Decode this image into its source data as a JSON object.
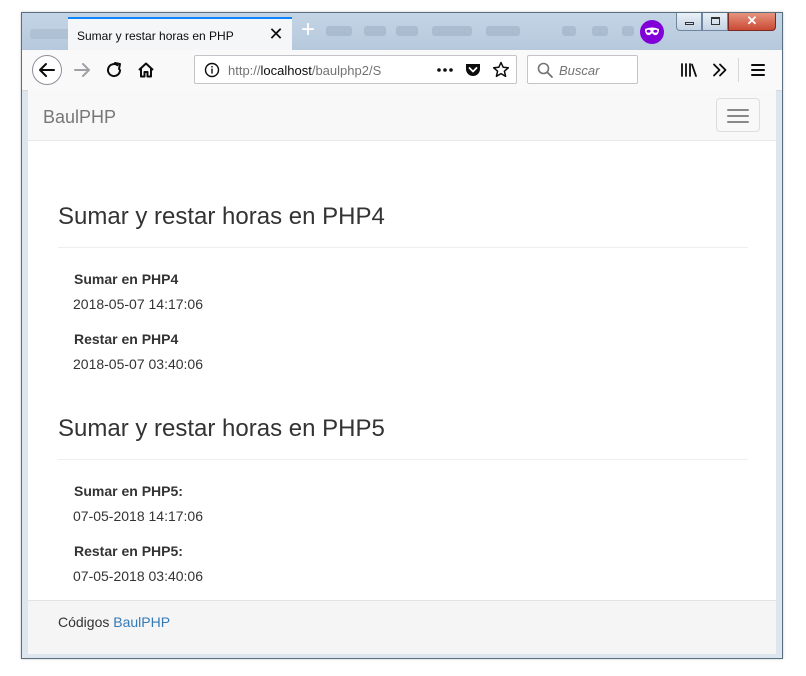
{
  "browser": {
    "tab_title": "Sumar y restar horas en PHP",
    "url_scheme": "http://",
    "url_host": "localhost",
    "url_path": "/baulphp2/S",
    "search_placeholder": "Buscar",
    "accent_color": "#0a84ff",
    "private_color": "#8000d7"
  },
  "navbar": {
    "brand": "BaulPHP"
  },
  "sections": [
    {
      "title": "Sumar y restar horas en PHP4",
      "items": [
        {
          "label": "Sumar en PHP4",
          "value": "2018-05-07 14:17:06"
        },
        {
          "label": "Restar en PHP4",
          "value": "2018-05-07 03:40:06"
        }
      ]
    },
    {
      "title": "Sumar y restar horas en PHP5",
      "items": [
        {
          "label": "Sumar en PHP5:",
          "value": "07-05-2018 14:17:06"
        },
        {
          "label": "Restar en PHP5:",
          "value": "07-05-2018 03:40:06"
        }
      ]
    }
  ],
  "footer": {
    "text": "Códigos ",
    "link": "BaulPHP",
    "link_color": "#337ab7"
  }
}
